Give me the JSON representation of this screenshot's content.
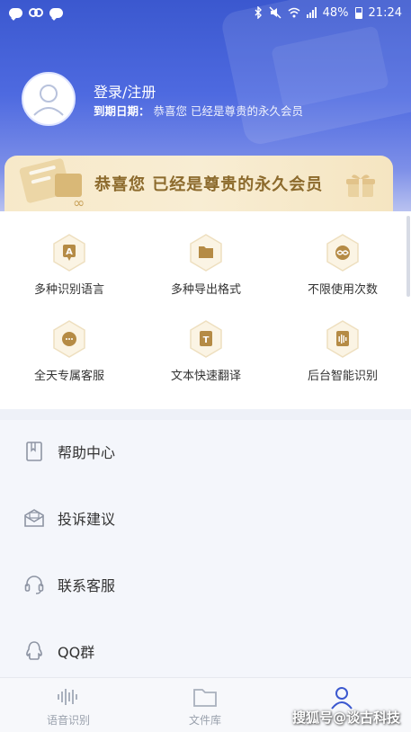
{
  "status_bar": {
    "battery": "48%",
    "time": "21:24"
  },
  "profile": {
    "login_label": "登录/注册",
    "expiry_key": "到期日期：",
    "expiry_value": "恭喜您 已经是尊贵的永久会员"
  },
  "vip_banner": {
    "text": "恭喜您 已经是尊贵的永久会员"
  },
  "features": [
    {
      "label": "多种识别语言",
      "icon": "language-a-icon"
    },
    {
      "label": "多种导出格式",
      "icon": "folder-icon"
    },
    {
      "label": "不限使用次数",
      "icon": "infinity-icon"
    },
    {
      "label": "全天专属客服",
      "icon": "chat-dots-icon"
    },
    {
      "label": "文本快速翻译",
      "icon": "text-t-icon"
    },
    {
      "label": "后台智能识别",
      "icon": "soundwave-icon"
    }
  ],
  "menu": [
    {
      "label": "帮助中心",
      "icon": "book-icon"
    },
    {
      "label": "投诉建议",
      "icon": "mail-icon"
    },
    {
      "label": "联系客服",
      "icon": "headset-icon"
    },
    {
      "label": "QQ群",
      "icon": "qq-penguin-icon"
    }
  ],
  "tabbar": [
    {
      "label": "语音识别",
      "icon": "soundwave-icon"
    },
    {
      "label": "文件库",
      "icon": "folder-icon"
    },
    {
      "label": "",
      "icon": "person-icon"
    }
  ],
  "watermark": "搜狐号@谈古科技",
  "colors": {
    "accent": "#4e6ae0",
    "gold": "#b58b45",
    "active_tab": "#3b58cf"
  }
}
